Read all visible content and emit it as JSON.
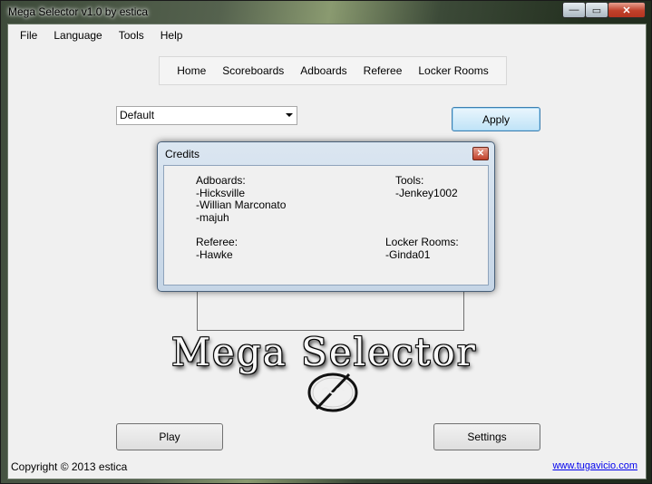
{
  "window": {
    "title": "Mega Selector v1.0 by estica",
    "minimize": "—",
    "maximize": "▭",
    "close": "✕"
  },
  "menu": [
    "File",
    "Language",
    "Tools",
    "Help"
  ],
  "nav": [
    "Home",
    "Scoreboards",
    "Adboards",
    "Referee",
    "Locker Rooms"
  ],
  "preset": {
    "selected": "Default"
  },
  "buttons": {
    "apply": "Apply",
    "play": "Play",
    "settings": "Settings"
  },
  "logo": {
    "text": "Mega Selector"
  },
  "footer": {
    "copyright": "Copyright © 2013 estica",
    "link": "www.tugavicio.com"
  },
  "credits": {
    "title": "Credits",
    "close": "✕",
    "adboards": {
      "heading": "Adboards:",
      "names": [
        "-Hicksville",
        "-Willian Marconato",
        "-majuh"
      ]
    },
    "tools": {
      "heading": "Tools:",
      "names": [
        "-Jenkey1002"
      ]
    },
    "referee": {
      "heading": "Referee:",
      "names": [
        "-Hawke"
      ]
    },
    "locker_rooms": {
      "heading": "Locker Rooms:",
      "names": [
        "-Ginda01"
      ]
    }
  }
}
